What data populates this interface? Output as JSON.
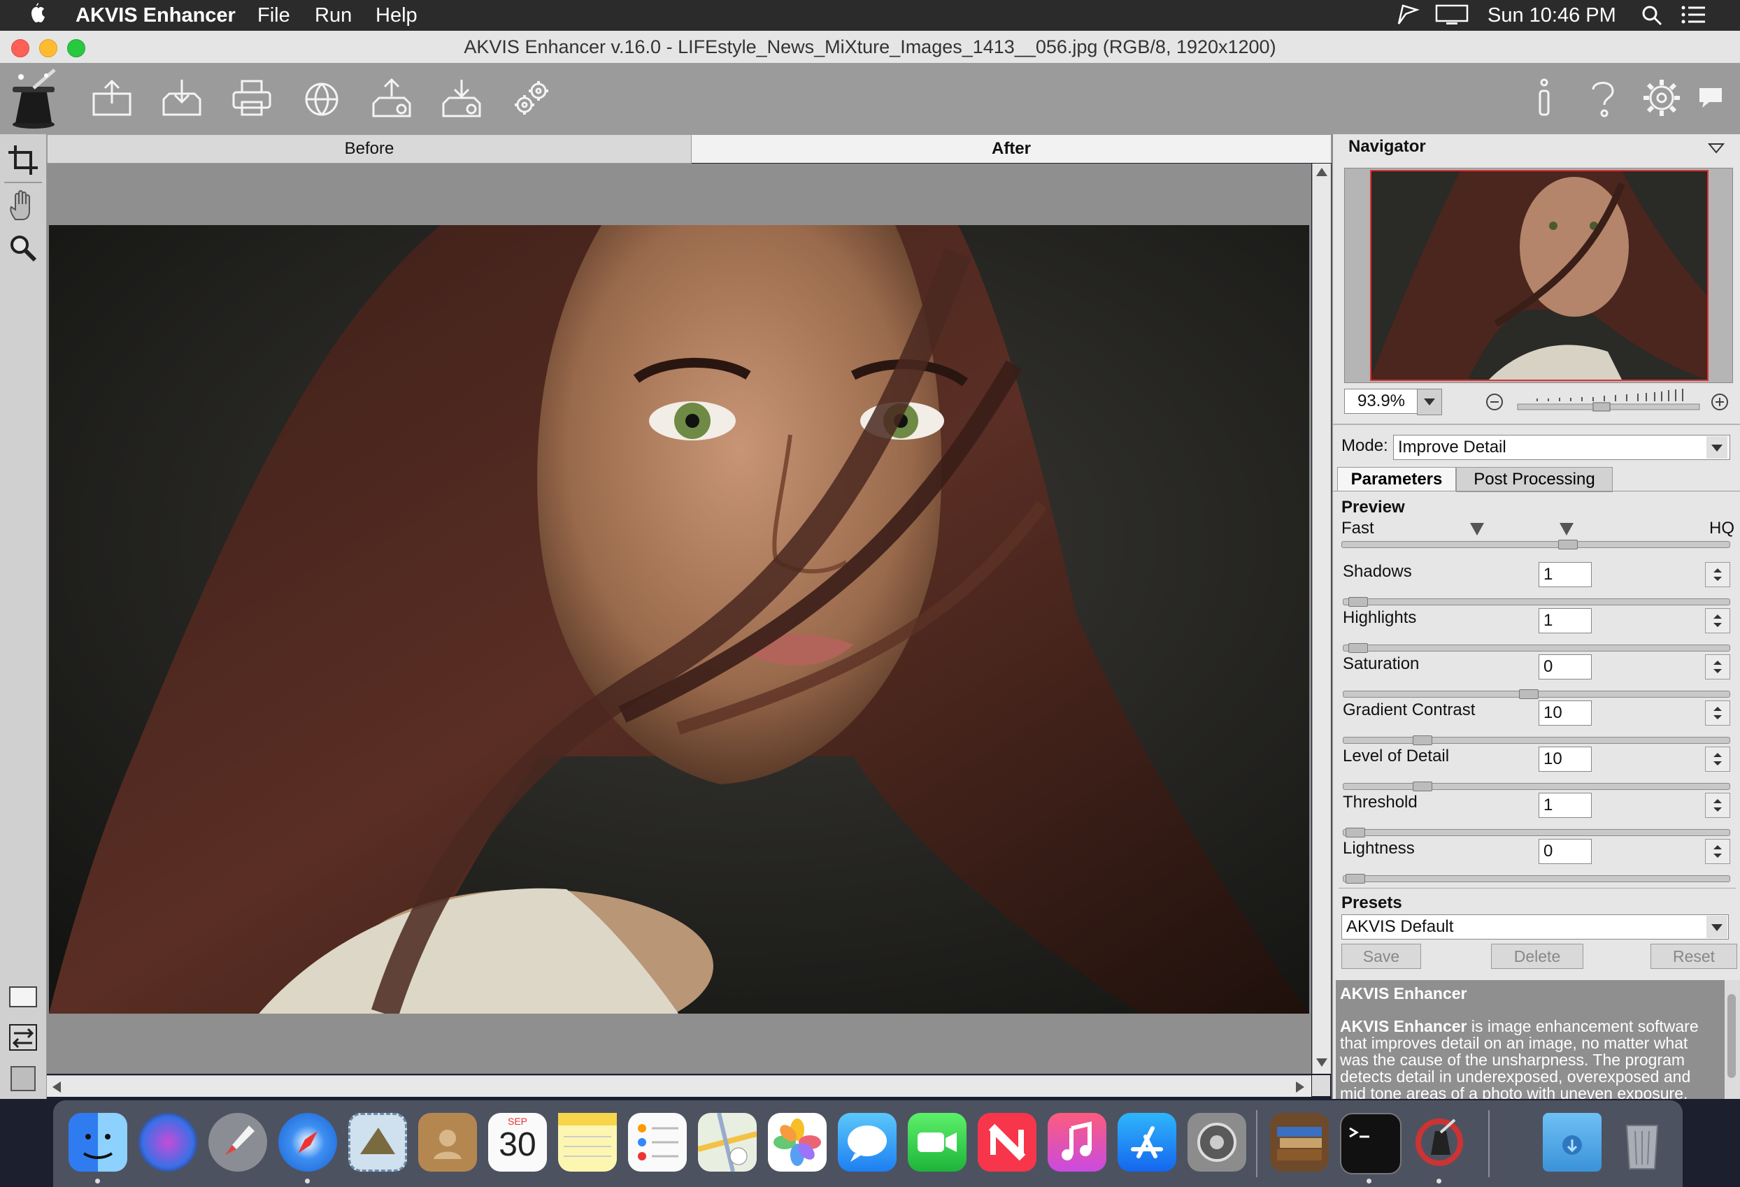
{
  "menubar": {
    "app_name": "AKVIS Enhancer",
    "menus": [
      "File",
      "Run",
      "Help"
    ],
    "clock": "Sun 10:46 PM"
  },
  "window": {
    "title": "AKVIS Enhancer v.16.0 - LIFEstyle_News_MiXture_Images_1413__056.jpg (RGB/8, 1920x1200)"
  },
  "toolbar": {
    "icons": [
      "open-icon",
      "save-icon",
      "print-icon",
      "share-icon",
      "import-preset-icon",
      "export-preset-icon",
      "batch-settings-icon",
      "info-icon",
      "help-icon",
      "preferences-icon",
      "hints-icon"
    ]
  },
  "view_tabs": {
    "before": "Before",
    "after": "After"
  },
  "navigator": {
    "title": "Navigator",
    "zoom": "93.9%"
  },
  "settings": {
    "mode_label": "Mode:",
    "mode_value": "Improve Detail",
    "tabs": [
      "Parameters",
      "Post Processing"
    ],
    "preview_label": "Preview",
    "preview_fast": "Fast",
    "preview_hq": "HQ",
    "params": [
      {
        "label": "Shadows",
        "value": "1"
      },
      {
        "label": "Highlights",
        "value": "1"
      },
      {
        "label": "Saturation",
        "value": "0"
      },
      {
        "label": "Gradient Contrast",
        "value": "10"
      },
      {
        "label": "Level of Detail",
        "value": "10"
      },
      {
        "label": "Threshold",
        "value": "1"
      },
      {
        "label": "Lightness",
        "value": "0"
      }
    ],
    "presets_label": "Presets",
    "preset_value": "AKVIS Default",
    "save": "Save",
    "delete": "Delete",
    "reset": "Reset"
  },
  "info": {
    "title": "AKVIS Enhancer",
    "body_bold": "AKVIS Enhancer",
    "body": " is image enhancement software that improves detail on an image, no matter what was the cause of the unsharpness. The program detects detail in underexposed, overexposed and mid tone areas of a photo with uneven exposure."
  },
  "dock": {
    "calendar_month": "SEP",
    "calendar_day": "30"
  }
}
